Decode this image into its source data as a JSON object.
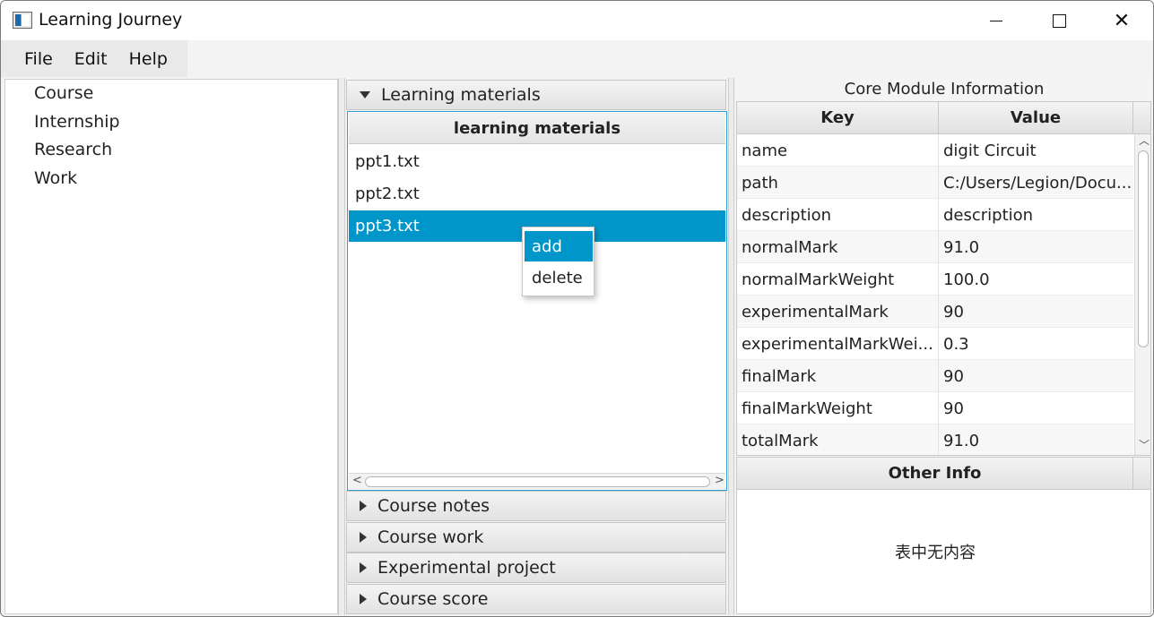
{
  "window": {
    "title": "Learning Journey"
  },
  "menubar": {
    "items": [
      "File",
      "Edit",
      "Help"
    ]
  },
  "tree": {
    "items": [
      "Course",
      "Internship",
      "Research",
      "Work"
    ]
  },
  "accordion": {
    "expanded": {
      "label": "Learning materials",
      "list_header": "learning materials",
      "files": [
        "ppt1.txt",
        "ppt2.txt",
        "ppt3.txt"
      ],
      "selected_file": "ppt3.txt"
    },
    "collapsed": [
      "Course notes",
      "Course work",
      "Experimental project",
      "Course score"
    ]
  },
  "context_menu": {
    "items": [
      "add",
      "delete"
    ],
    "highlighted": "add"
  },
  "core_module": {
    "title": "Core Module Information",
    "columns": [
      "Key",
      "Value"
    ],
    "rows": [
      {
        "key": "name",
        "value": "digit Circuit"
      },
      {
        "key": "path",
        "value": "C:/Users/Legion/Docu..."
      },
      {
        "key": "description",
        "value": "description"
      },
      {
        "key": "normalMark",
        "value": "91.0"
      },
      {
        "key": "normalMarkWeight",
        "value": "100.0"
      },
      {
        "key": "experimentalMark",
        "value": "90"
      },
      {
        "key": "experimentalMarkWei...",
        "value": "0.3"
      },
      {
        "key": "finalMark",
        "value": "90"
      },
      {
        "key": "finalMarkWeight",
        "value": "90"
      },
      {
        "key": "totalMark",
        "value": "91.0"
      }
    ]
  },
  "other_info": {
    "header": "Other Info",
    "empty_message": "表中无内容"
  },
  "colors": {
    "selection": "#0096c9",
    "focus_border": "#2a9fd6"
  }
}
